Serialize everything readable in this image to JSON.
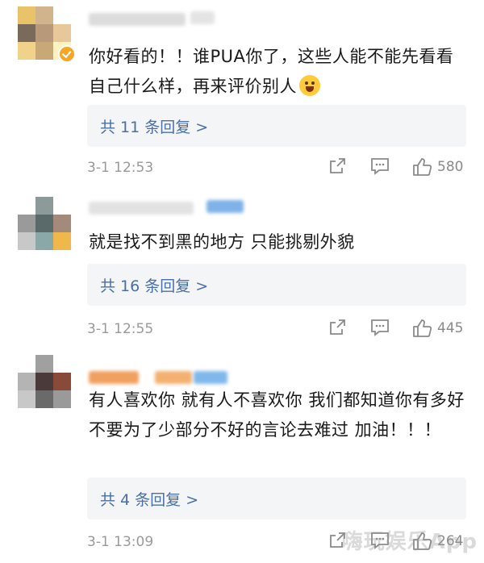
{
  "comments": [
    {
      "text": "你好看的！！谁PUA你了，这些人能不能先看看自己什么样，再来评价别人",
      "emoji": "smiling-face-emoji",
      "replies_label": "共 11 条回复 >",
      "time": "3-1 12:53",
      "likes": "580"
    },
    {
      "text": "就是找不到黑的地方 只能挑剔外貌",
      "replies_label": "共 16 条回复 >",
      "time": "3-1 12:55",
      "likes": "445"
    },
    {
      "text": "有人喜欢你 就有人不喜欢你 我们都知道你有多好 不要为了少部分不好的言论去难过 加油！！！",
      "replies_label": "共 4 条回复 >",
      "time": "3-1 13:09",
      "likes": "264"
    }
  ],
  "icons": {
    "share": "share-icon",
    "comment": "comment-icon",
    "like": "thumbs-up-icon"
  },
  "colors": {
    "reply_link": "#4a6fa5",
    "reply_bg": "#f4f5f7",
    "timestamp": "#9a9a9a",
    "verified_badge": "#f5a623"
  },
  "watermark": "嗨玩娱乐App"
}
